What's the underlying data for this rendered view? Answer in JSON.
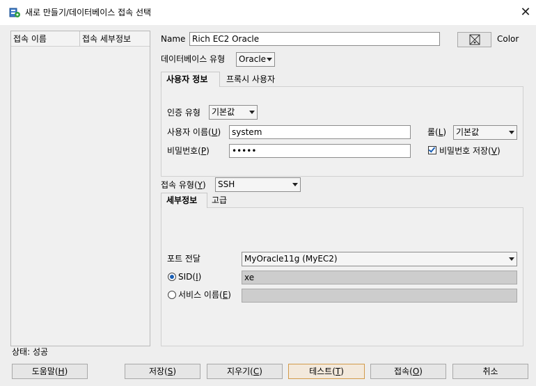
{
  "window": {
    "title": "새로 만들기/데이터베이스 접속 선택",
    "close_glyph": "✕"
  },
  "connections_list": {
    "columns": [
      "접속 이름",
      "접속 세부정보"
    ]
  },
  "status": "상태: 성공",
  "form": {
    "name_label": "Name",
    "name_value": "Rich EC2 Oracle",
    "color_label": "Color",
    "db_type_label": "데이터베이스 유형",
    "db_type_value": "Oracle",
    "tabs": [
      "사용자 정보",
      "프록시 사용자"
    ],
    "auth_type_label": "인증 유형",
    "auth_type_value": "기본값",
    "username_label": "사용자 이름(U)",
    "username_prefix": "사용자 이름(",
    "username_key": "U",
    "username_value": "system",
    "role_prefix": "롤(",
    "role_key": "L",
    "role_value": "기본값",
    "password_prefix": "비밀번호(",
    "password_key": "P",
    "password_value": "•••••",
    "save_password_prefix": "비밀번호 저장(",
    "save_password_key": "V",
    "save_password_checked": true,
    "conn_type_prefix": "접속 유형(",
    "conn_type_key": "Y",
    "conn_type_value": "SSH",
    "detail_tabs": [
      "세부정보",
      "고급"
    ],
    "port_forward_label": "포트 전달",
    "port_forward_value": "MyOracle11g (MyEC2)",
    "sid_prefix": "SID(",
    "sid_key": "I",
    "sid_value": "xe",
    "sid_selected": true,
    "service_prefix": "서비스 이름(",
    "service_key": "E",
    "service_value": ""
  },
  "buttons": {
    "help_prefix": "도움말(",
    "help_key": "H",
    "save_prefix": "저장(",
    "save_key": "S",
    "clear_prefix": "지우기(",
    "clear_key": "C",
    "test_prefix": "테스트(",
    "test_key": "T",
    "connect_prefix": "접속(",
    "connect_key": "O",
    "cancel": "취소"
  },
  "icons": {
    "title": "connection-plug-icon",
    "color": "color-picker-icon",
    "close": "close-icon"
  }
}
